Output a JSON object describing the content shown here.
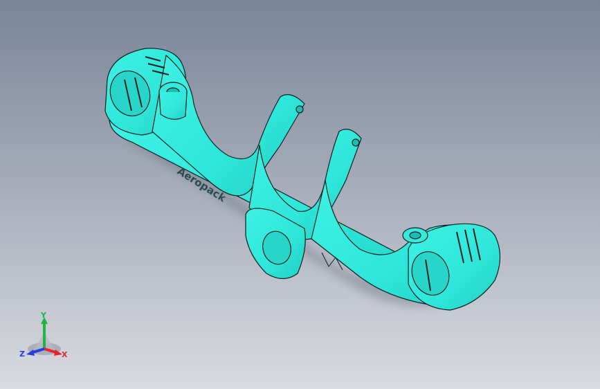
{
  "viewport": {
    "background_top": "#7a859a",
    "background_bottom": "#d9dbe0"
  },
  "model": {
    "part_color": "#2ee6d9",
    "edge_color": "#0a1f1e",
    "engraved_text": "Aeropack"
  },
  "triad": {
    "x_label": "X",
    "y_label": "Y",
    "z_label": "Z",
    "x_color": "#e8242a",
    "y_color": "#22b24c",
    "z_color": "#2e3be0"
  }
}
